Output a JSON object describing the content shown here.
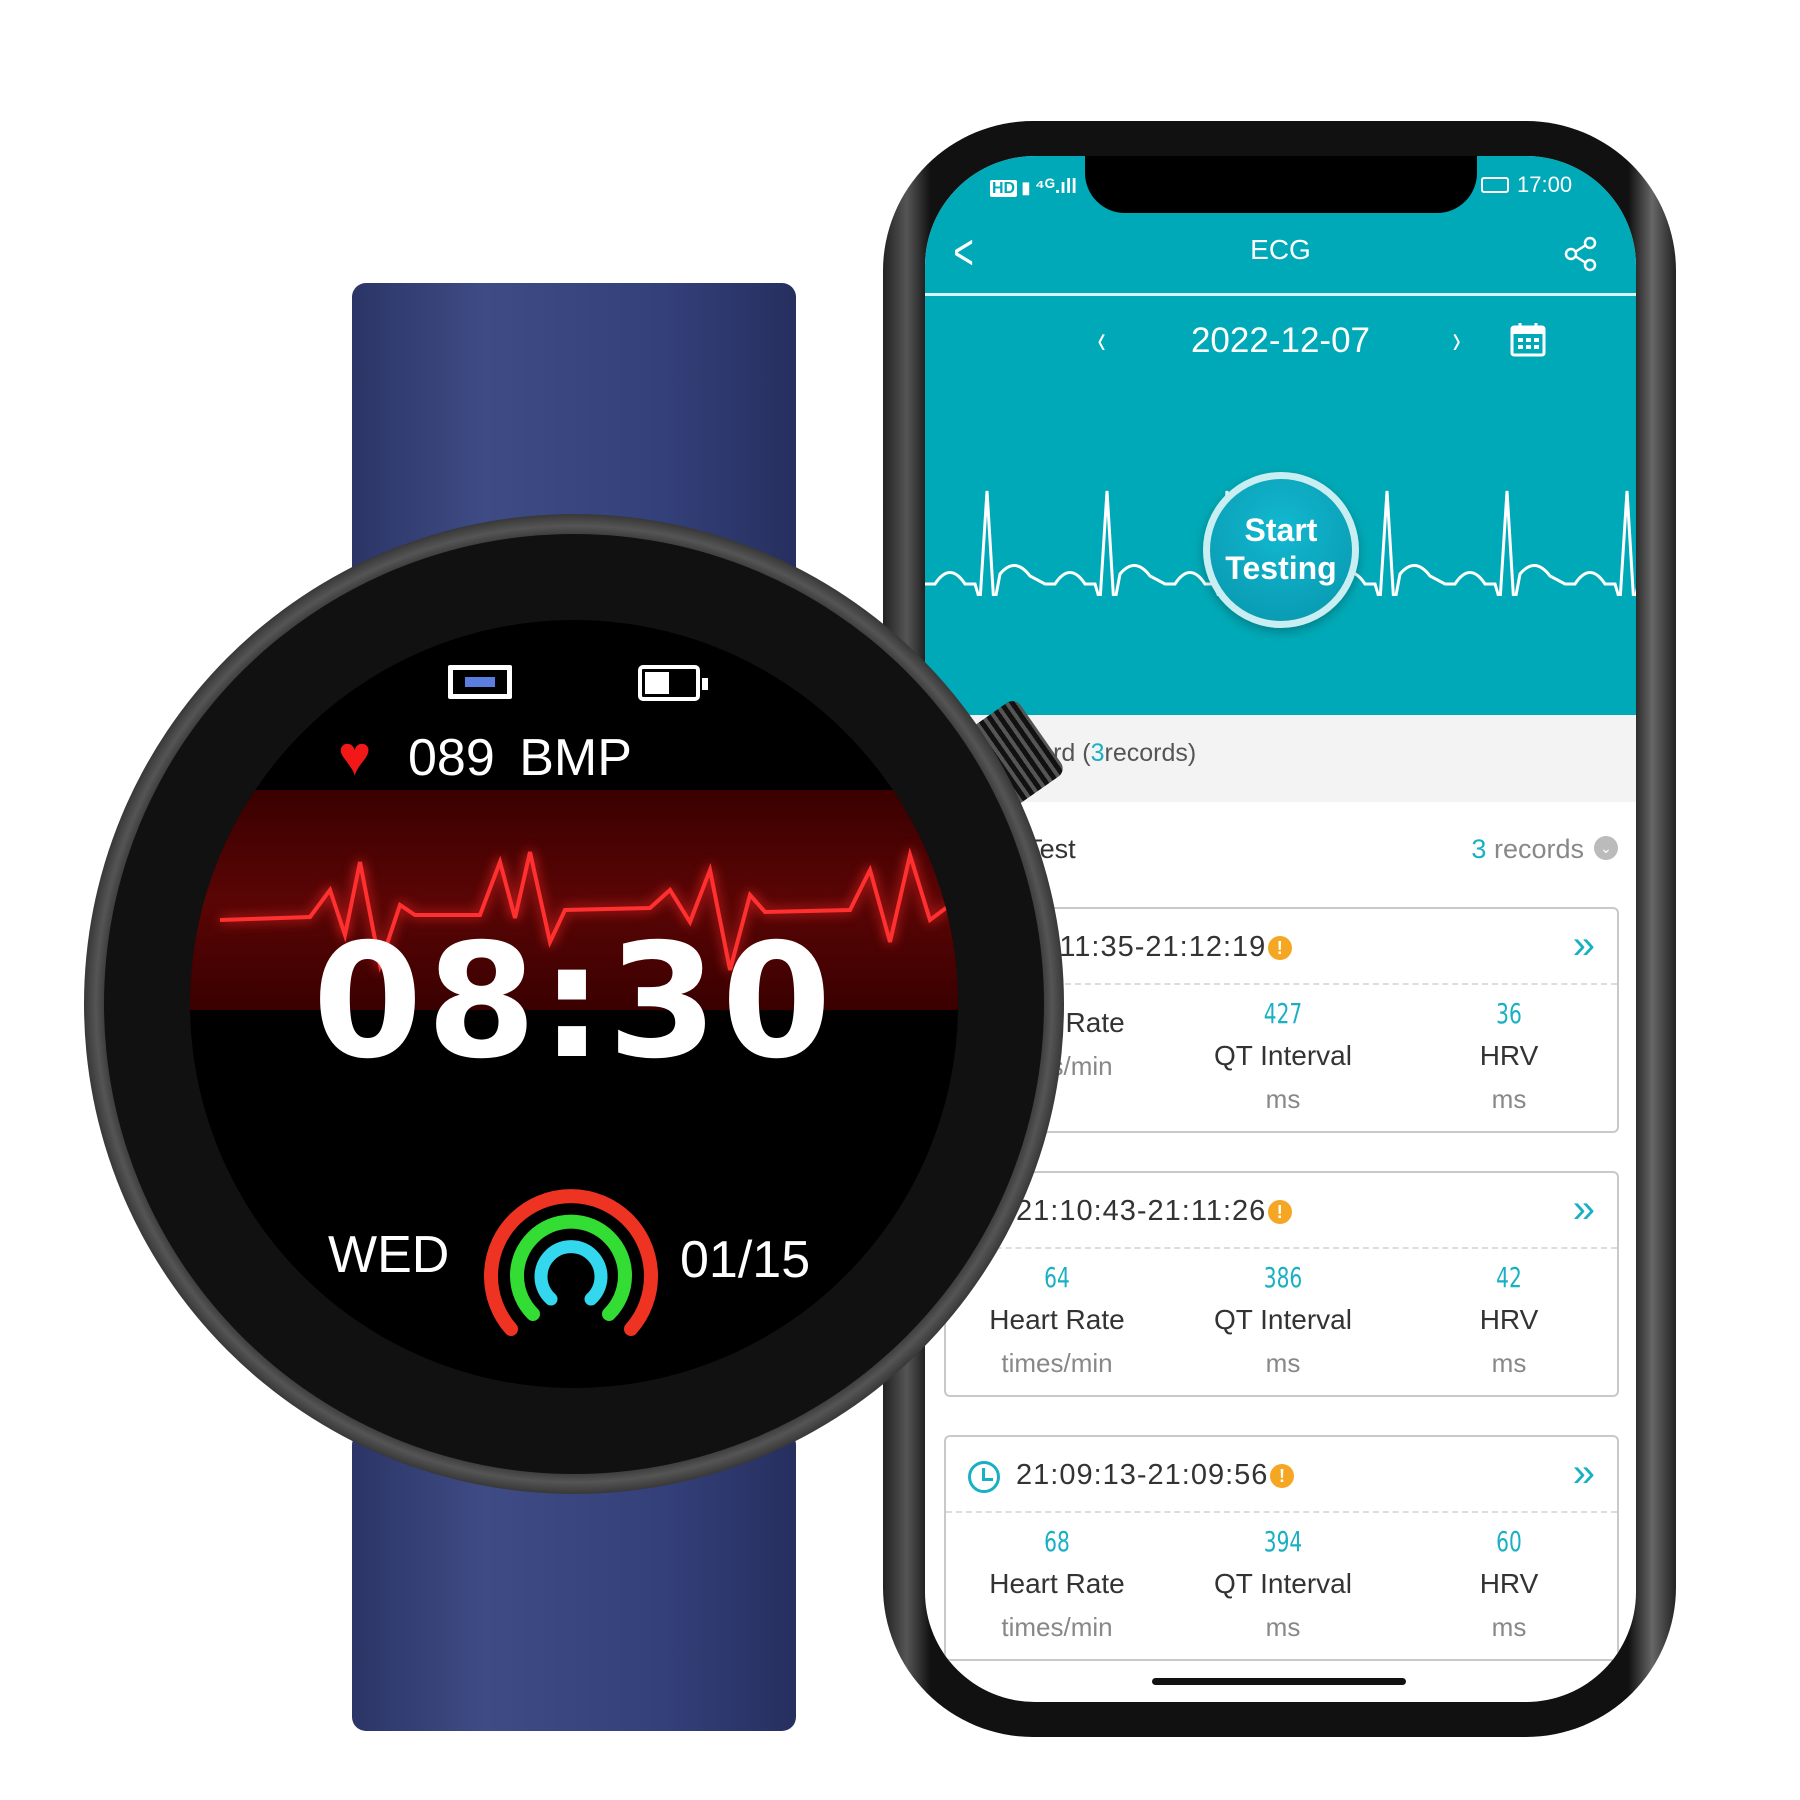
{
  "phone": {
    "status_bar": {
      "left_icons": [
        "hd-icon",
        "sim-icon",
        "4g-signal-icon"
      ],
      "time": "17:00",
      "battery_icon": "battery-icon"
    },
    "nav": {
      "title": "ECG",
      "back_icon": "chevron-left-icon",
      "share_icon": "share-icon"
    },
    "date_nav": {
      "date": "2022-12-07",
      "prev": "‹",
      "next": "›",
      "calendar_icon": "calendar-icon"
    },
    "start_button": {
      "line1": "Start",
      "line2": "Testing"
    },
    "history": {
      "title_prefix": "Historical Record (",
      "count": "3",
      "title_suffix": "records)"
    },
    "group": {
      "title": "App ECG Test",
      "count": "3",
      "count_suffix": " records"
    },
    "records": [
      {
        "time": "21:11:35-21:12:19",
        "heart_rate": "",
        "qt_interval": "427",
        "hrv": "36"
      },
      {
        "time": "21:10:43-21:11:26",
        "heart_rate": "64",
        "qt_interval": "386",
        "hrv": "42"
      },
      {
        "time": "21:09:13-21:09:56",
        "heart_rate": "68",
        "qt_interval": "394",
        "hrv": "60"
      }
    ],
    "labels": {
      "heart_rate": "Heart Rate",
      "heart_rate_unit": "times/min",
      "qt": "QT Interval",
      "qt_unit": "ms",
      "hrv": "HRV",
      "hrv_unit": "ms",
      "warn": "!",
      "more": "»"
    }
  },
  "watch": {
    "heart_rate": "089",
    "heart_unit": "BMP",
    "time": "08:30",
    "day": "WED",
    "date": "01/15"
  },
  "colors": {
    "teal": "#00a9b7",
    "accent": "#1ab0c4",
    "warning": "#f5a623",
    "ecg_red": "#ff2020",
    "band": "#34407a"
  }
}
